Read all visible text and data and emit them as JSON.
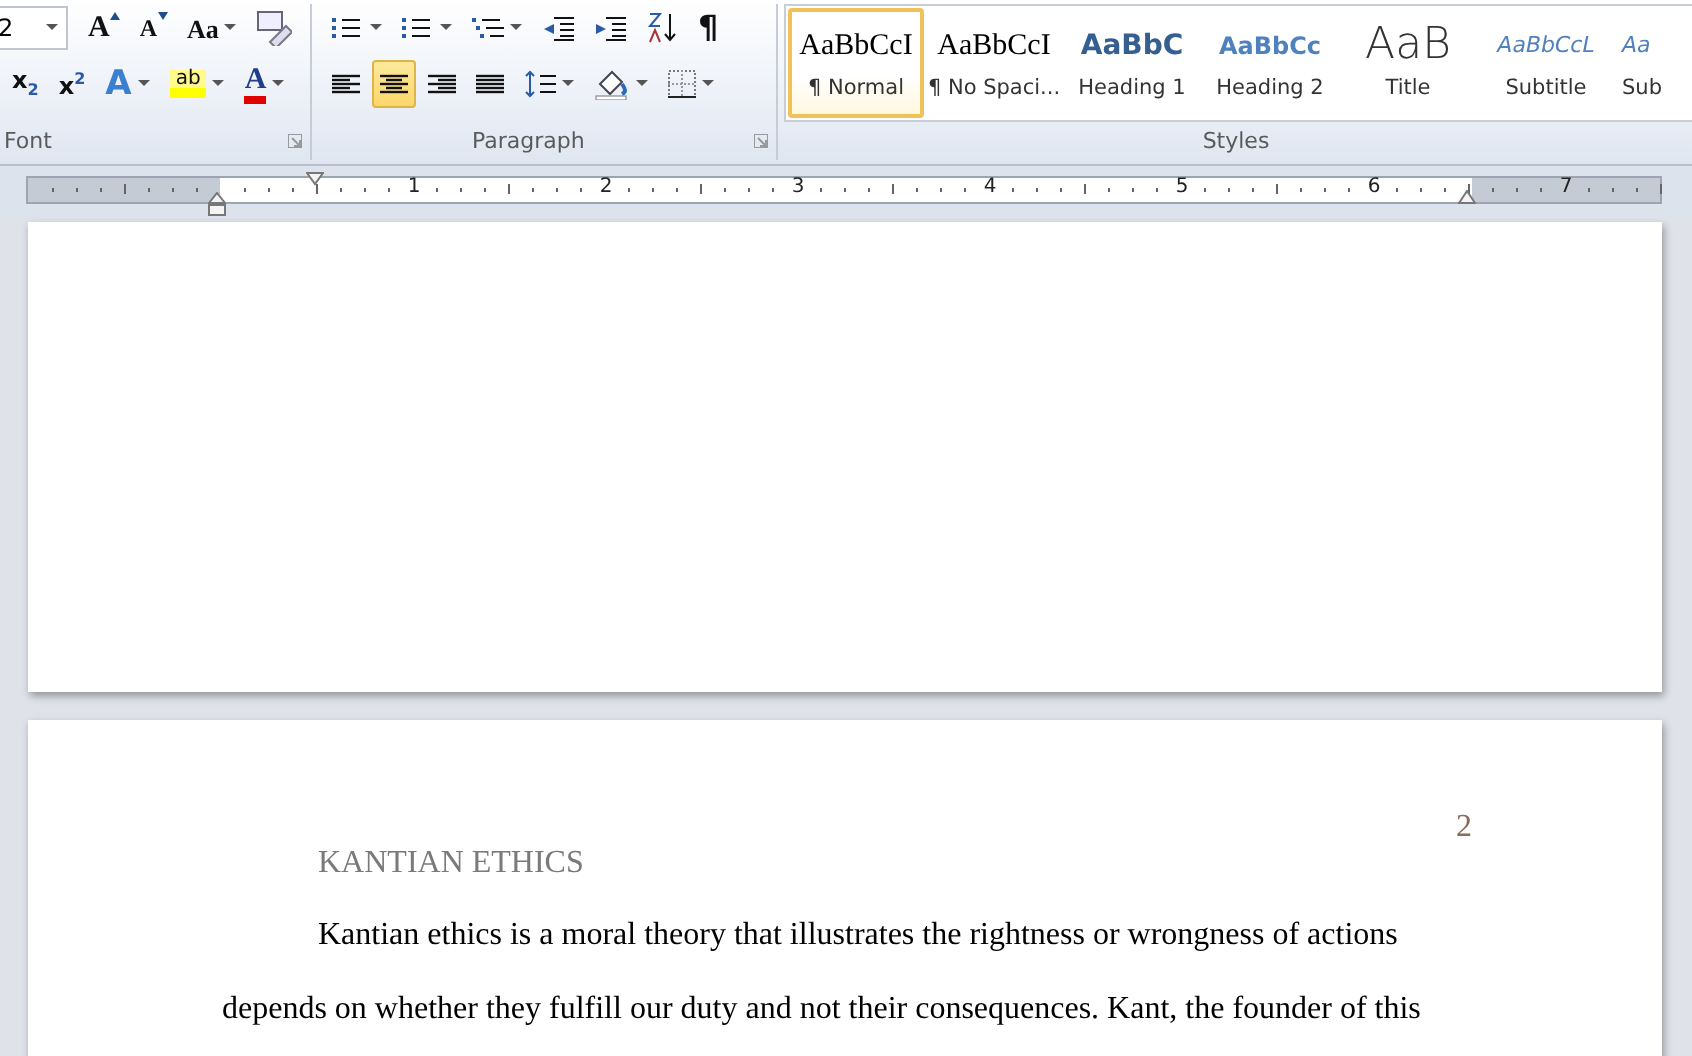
{
  "ribbon": {
    "font_group": {
      "label": "Font",
      "font_size": "2",
      "row_1": [
        {
          "kind": "grow",
          "glyph": "A",
          "dropdown": false
        },
        {
          "kind": "shrink",
          "glyph": "A",
          "dropdown": false
        },
        {
          "kind": "case",
          "glyph": "Aa",
          "dropdown": true
        },
        {
          "kind": "clear",
          "dropdown": false
        }
      ],
      "row_2": [
        {
          "kind": "subscript",
          "glyph": "x",
          "index": "2",
          "dropdown": false
        },
        {
          "kind": "superscript",
          "glyph": "x",
          "index": "2",
          "dropdown": false
        },
        {
          "kind": "effects",
          "glyph": "A",
          "dropdown": true
        },
        {
          "kind": "highlight",
          "glyph": "ab",
          "dropdown": true
        },
        {
          "kind": "fontcolor",
          "glyph": "A",
          "dropdown": true
        }
      ]
    },
    "paragraph_group": {
      "label": "Paragraph",
      "row_1": [
        {
          "kind": "bullets",
          "dropdown": true,
          "selected": false
        },
        {
          "kind": "numbering",
          "dropdown": true,
          "selected": false
        },
        {
          "kind": "multilevel",
          "dropdown": true,
          "selected": false
        },
        {
          "kind": "outdent",
          "dropdown": false,
          "selected": false
        },
        {
          "kind": "indent",
          "dropdown": false,
          "selected": false
        },
        {
          "kind": "sort",
          "dropdown": false,
          "selected": false
        },
        {
          "kind": "pilcrow",
          "glyph": "¶",
          "dropdown": false,
          "selected": false
        }
      ],
      "row_2": [
        {
          "kind": "align_left",
          "dropdown": false,
          "selected": false
        },
        {
          "kind": "align_center",
          "dropdown": false,
          "selected": true
        },
        {
          "kind": "align_right",
          "dropdown": false,
          "selected": false
        },
        {
          "kind": "justify",
          "dropdown": false,
          "selected": false
        },
        {
          "kind": "spacing",
          "dropdown": true,
          "selected": false
        },
        {
          "kind": "shading",
          "dropdown": true,
          "selected": false
        },
        {
          "kind": "borders",
          "dropdown": true,
          "selected": false
        }
      ]
    },
    "styles_group": {
      "label": "Styles",
      "items": [
        {
          "kind": "normal",
          "preview": "AaBbCcI",
          "name": "¶ Normal",
          "selected": true
        },
        {
          "kind": "normal",
          "preview": "AaBbCcI",
          "name": "¶ No Spaci...",
          "selected": false
        },
        {
          "kind": "heading1",
          "preview": "AaBbC",
          "name": "Heading 1",
          "selected": false
        },
        {
          "kind": "heading2",
          "preview": "AaBbCc",
          "name": "Heading 2",
          "selected": false
        },
        {
          "kind": "title",
          "preview": "AaB",
          "name": "Title",
          "selected": false
        },
        {
          "kind": "subtitle",
          "preview": "AaBbCcL",
          "name": "Subtitle",
          "selected": false
        },
        {
          "kind": "subtitle",
          "preview": "Aa",
          "name": "Sub",
          "selected": false
        }
      ]
    }
  },
  "ruler": {
    "numbers": [
      "1",
      "2",
      "3",
      "4",
      "5",
      "6",
      "7"
    ]
  },
  "document": {
    "page_number": "2",
    "running_head": "KANTIAN ETHICS",
    "paragraph": "Kantian ethics is a moral theory that illustrates the rightness or wrongness of actions depends on whether they fulfill our duty and not their consequences. Kant, the founder of this"
  }
}
